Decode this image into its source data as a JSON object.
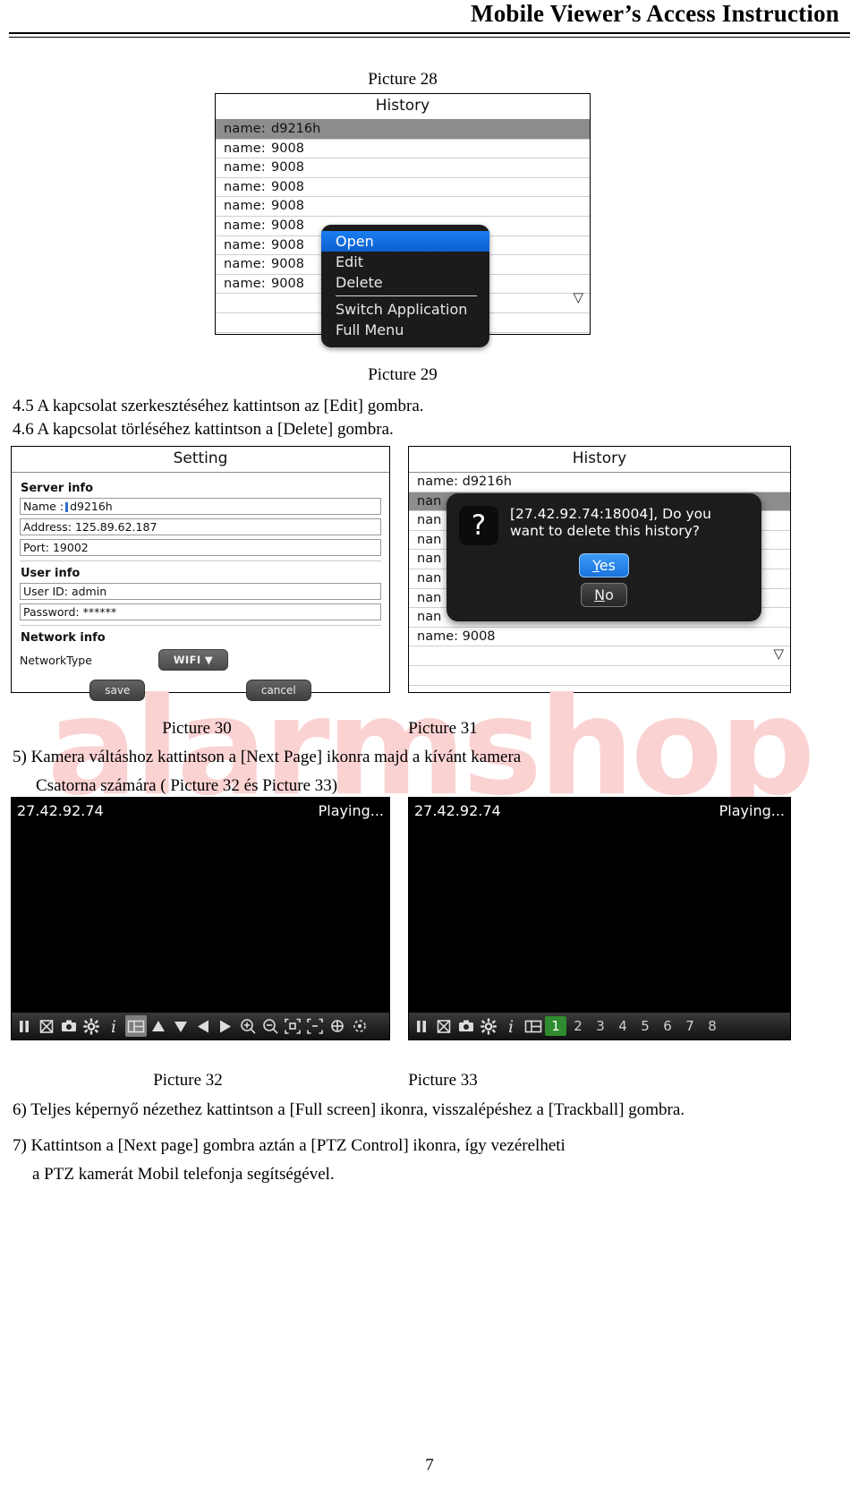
{
  "header": {
    "title": "Mobile Viewer’s Access Instruction"
  },
  "captions": {
    "pic28": "Picture 28",
    "pic29": "Picture 29",
    "pic30": "Picture 30",
    "pic31": "Picture 31",
    "pic32": "Picture 32",
    "pic33": "Picture 33"
  },
  "paragraphs": {
    "p45": "4.5 A kapcsolat szerkesztéséhez kattintson az [Edit] gombra.",
    "p46": "4.6 A kapcsolat törléséhez kattintson a [Delete] gombra.",
    "p5_line1": "5) Kamera váltáshoz kattintson a [Next Page] ikonra majd a kívánt kamera",
    "p5_line2": "Csatorna számára ( Picture 32 és Picture 33)",
    "p6": "6) Teljes képernyő  nézethez kattintson a [Full screen] ikonra, visszalépéshez a [Trackball] gombra.",
    "p7_line1": "7) Kattintson a [Next page] gombra aztán a [PTZ Control] ikonra, így vezérelheti",
    "p7_line2": "a PTZ kamerát Mobil telefonja segítségével."
  },
  "watermark": {
    "text": "alarmshop",
    "color": "#fbd2d2"
  },
  "history_screen": {
    "title": "History",
    "rows": [
      {
        "key": "name:",
        "value": "d9216h",
        "selected": true
      },
      {
        "key": "name:",
        "value": "9008",
        "selected": false
      },
      {
        "key": "name:",
        "value": "9008",
        "selected": false
      },
      {
        "key": "name:",
        "value": "9008",
        "selected": false
      },
      {
        "key": "name:",
        "value": "9008",
        "selected": false
      },
      {
        "key": "name:",
        "value": "9008",
        "selected": false
      },
      {
        "key": "name:",
        "value": "9008",
        "selected": false
      },
      {
        "key": "name:",
        "value": "9008",
        "selected": false
      },
      {
        "key": "name:",
        "value": "9008",
        "selected": false
      }
    ],
    "scroll_indicator": "▽",
    "context_menu": {
      "items": [
        {
          "label": "Open",
          "active": true
        },
        {
          "label": "Edit",
          "active": false
        },
        {
          "label": "Delete",
          "active": false
        },
        {
          "label": "Switch Application",
          "active": false
        },
        {
          "label": "Full Menu",
          "active": false
        }
      ],
      "separator_after_index": 2,
      "highlight_color": "#1a7ef0"
    }
  },
  "setting_screen": {
    "title": "Setting",
    "groups": {
      "server_info_label": "Server info",
      "user_info_label": "User info",
      "network_info_label": "Network info"
    },
    "fields": {
      "name_label": "Name :",
      "name_value": "d9216h",
      "address": "Address: 125.89.62.187",
      "port": "Port: 19002",
      "user_id": "User ID: admin",
      "password": "Password: ******"
    },
    "network_type_label": "NetworkType",
    "network_type_value": "WIFI",
    "network_type_caret": "▼",
    "save_label": "save",
    "cancel_label": "cancel"
  },
  "history_delete_screen": {
    "title": "History",
    "rows": [
      {
        "text": "name:    d9216h",
        "selected": false
      },
      {
        "text": "nan",
        "selected": true
      },
      {
        "text": "nan",
        "selected": false
      },
      {
        "text": "nan",
        "selected": false
      },
      {
        "text": "nan",
        "selected": false
      },
      {
        "text": "nan",
        "selected": false
      },
      {
        "text": "nan",
        "selected": false
      },
      {
        "text": "nan",
        "selected": false
      },
      {
        "text": "name: 9008",
        "selected": false
      }
    ],
    "scroll_indicator": "▽",
    "dialog": {
      "icon": "?",
      "message": "[27.42.92.74:18004], Do you want to delete this history?",
      "yes_label": "Yes",
      "yes_accel": "Y",
      "no_label": "No",
      "no_accel": "N",
      "yes_color": "#2f8ef0"
    }
  },
  "player_left": {
    "ip": "27.42.92.74",
    "status": "Playing...",
    "toolbar": [
      {
        "icon": "pause-icon",
        "label": ""
      },
      {
        "icon": "stop-cross-icon",
        "label": ""
      },
      {
        "icon": "snapshot-camera-icon",
        "label": ""
      },
      {
        "icon": "settings-gear-icon",
        "label": ""
      },
      {
        "icon": "info-icon",
        "label": ""
      },
      {
        "icon": "next-page-icon",
        "label": "",
        "active": true
      },
      {
        "icon": "arrow-up-icon",
        "label": ""
      },
      {
        "icon": "arrow-down-icon",
        "label": ""
      },
      {
        "icon": "arrow-left-icon",
        "label": ""
      },
      {
        "icon": "arrow-right-icon",
        "label": ""
      },
      {
        "icon": "zoom-in-icon",
        "label": ""
      },
      {
        "icon": "zoom-out-icon",
        "label": ""
      },
      {
        "icon": "focus-near-icon",
        "label": ""
      },
      {
        "icon": "focus-far-icon",
        "label": ""
      },
      {
        "icon": "iris-open-icon",
        "label": ""
      },
      {
        "icon": "iris-close-icon",
        "label": ""
      }
    ]
  },
  "player_right": {
    "ip": "27.42.92.74",
    "status": "Playing...",
    "toolbar": [
      {
        "icon": "pause-icon",
        "label": ""
      },
      {
        "icon": "stop-cross-icon",
        "label": ""
      },
      {
        "icon": "snapshot-camera-icon",
        "label": ""
      },
      {
        "icon": "settings-gear-icon",
        "label": ""
      },
      {
        "icon": "info-icon",
        "label": ""
      },
      {
        "icon": "next-page-icon",
        "label": ""
      }
    ],
    "channels": [
      {
        "label": "1",
        "active": true
      },
      {
        "label": "2",
        "active": false
      },
      {
        "label": "3",
        "active": false
      },
      {
        "label": "4",
        "active": false
      },
      {
        "label": "5",
        "active": false
      },
      {
        "label": "6",
        "active": false
      },
      {
        "label": "7",
        "active": false
      },
      {
        "label": "8",
        "active": false
      }
    ],
    "active_channel_color": "#2f8b2f"
  },
  "footer": {
    "page_number": "7"
  }
}
